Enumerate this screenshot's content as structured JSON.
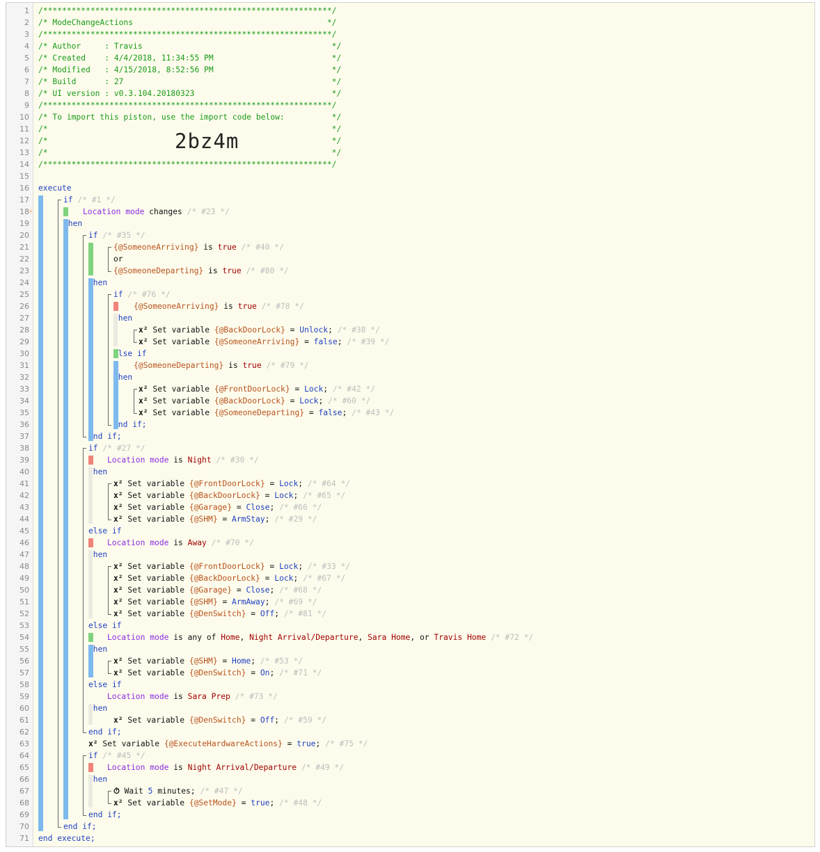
{
  "import_code": "2bz4m",
  "trigger_marker_line": 18,
  "colors": {
    "comment": "#1a9a1a",
    "keyword": "#1f3fc0",
    "variable": "#b8521d",
    "purple": "#8a2be2",
    "value": "#a00000",
    "faint": "#bdbdbd",
    "plain": "#111111"
  },
  "lines": [
    [
      [
        "c",
        "/*************************************************************/"
      ]
    ],
    [
      [
        "c",
        "/* ModeChangeActions                                         */"
      ]
    ],
    [
      [
        "c",
        "/*************************************************************/"
      ]
    ],
    [
      [
        "c",
        "/* Author     : Travis                                        */"
      ]
    ],
    [
      [
        "c",
        "/* Created    : 4/4/2018, 11:34:55 PM                         */"
      ]
    ],
    [
      [
        "c",
        "/* Modified   : 4/15/2018, 8:52:56 PM                         */"
      ]
    ],
    [
      [
        "c",
        "/* Build      : 27                                            */"
      ]
    ],
    [
      [
        "c",
        "/* UI version : v0.3.104.20180323                             */"
      ]
    ],
    [
      [
        "c",
        "/*************************************************************/"
      ]
    ],
    [
      [
        "c",
        "/* To import this piston, use the import code below:          */"
      ]
    ],
    [
      [
        "c",
        "/*                                                            */"
      ]
    ],
    [
      [
        "c",
        "/*                                                            */"
      ]
    ],
    [
      [
        "c",
        "/*                                                            */"
      ]
    ],
    [
      [
        "c",
        "/*************************************************************/"
      ]
    ],
    [],
    [
      [
        "k",
        "execute"
      ]
    ],
    [
      [
        "k",
        "if"
      ],
      [
        "f",
        " /* #1 */"
      ]
    ],
    [
      [
        "p",
        "Location mode"
      ],
      [
        "t",
        " changes"
      ],
      [
        "f",
        " /* #23 */"
      ]
    ],
    [
      [
        "k",
        "then"
      ]
    ],
    [
      [
        "k",
        "if"
      ],
      [
        "f",
        " /* #35 */"
      ]
    ],
    [
      [
        "v",
        "{@SomeoneArriving}"
      ],
      [
        "t",
        " is "
      ],
      [
        "r",
        "true"
      ],
      [
        "f",
        " /* #40 */"
      ]
    ],
    [
      [
        "t",
        "or"
      ]
    ],
    [
      [
        "v",
        "{@SomeoneDeparting}"
      ],
      [
        "t",
        " is "
      ],
      [
        "r",
        "true"
      ],
      [
        "f",
        " /* #80 */"
      ]
    ],
    [
      [
        "k",
        "then"
      ]
    ],
    [
      [
        "k",
        "if"
      ],
      [
        "f",
        " /* #76 */"
      ]
    ],
    [
      [
        "v",
        "{@SomeoneArriving}"
      ],
      [
        "t",
        " is "
      ],
      [
        "r",
        "true"
      ],
      [
        "f",
        " /* #78 */"
      ]
    ],
    [
      [
        "k",
        "then"
      ]
    ],
    [
      [
        "x",
        "x²"
      ],
      [
        "t",
        " Set variable "
      ],
      [
        "v",
        "{@BackDoorLock}"
      ],
      [
        "t",
        " = "
      ],
      [
        "k",
        "Unlock"
      ],
      [
        "t",
        ";"
      ],
      [
        "f",
        " /* #38 */"
      ]
    ],
    [
      [
        "x",
        "x²"
      ],
      [
        "t",
        " Set variable "
      ],
      [
        "v",
        "{@SomeoneArriving}"
      ],
      [
        "t",
        " = "
      ],
      [
        "k",
        "false"
      ],
      [
        "t",
        ";"
      ],
      [
        "f",
        " /* #39 */"
      ]
    ],
    [
      [
        "k",
        "else if"
      ]
    ],
    [
      [
        "v",
        "{@SomeoneDeparting}"
      ],
      [
        "t",
        " is "
      ],
      [
        "r",
        "true"
      ],
      [
        "f",
        " /* #79 */"
      ]
    ],
    [
      [
        "k",
        "then"
      ]
    ],
    [
      [
        "x",
        "x²"
      ],
      [
        "t",
        " Set variable "
      ],
      [
        "v",
        "{@FrontDoorLock}"
      ],
      [
        "t",
        " = "
      ],
      [
        "k",
        "Lock"
      ],
      [
        "t",
        ";"
      ],
      [
        "f",
        " /* #42 */"
      ]
    ],
    [
      [
        "x",
        "x²"
      ],
      [
        "t",
        " Set variable "
      ],
      [
        "v",
        "{@BackDoorLock}"
      ],
      [
        "t",
        " = "
      ],
      [
        "k",
        "Lock"
      ],
      [
        "t",
        ";"
      ],
      [
        "f",
        " /* #60 */"
      ]
    ],
    [
      [
        "x",
        "x²"
      ],
      [
        "t",
        " Set variable "
      ],
      [
        "v",
        "{@SomeoneDeparting}"
      ],
      [
        "t",
        " = "
      ],
      [
        "k",
        "false"
      ],
      [
        "t",
        ";"
      ],
      [
        "f",
        " /* #43 */"
      ]
    ],
    [
      [
        "k",
        "end if;"
      ]
    ],
    [
      [
        "k",
        "end if;"
      ]
    ],
    [
      [
        "k",
        "if"
      ],
      [
        "f",
        " /* #27 */"
      ]
    ],
    [
      [
        "p",
        "Location mode"
      ],
      [
        "t",
        " is "
      ],
      [
        "r",
        "Night"
      ],
      [
        "f",
        " /* #30 */"
      ]
    ],
    [
      [
        "k",
        "then"
      ]
    ],
    [
      [
        "x",
        "x²"
      ],
      [
        "t",
        " Set variable "
      ],
      [
        "v",
        "{@FrontDoorLock}"
      ],
      [
        "t",
        " = "
      ],
      [
        "k",
        "Lock"
      ],
      [
        "t",
        ";"
      ],
      [
        "f",
        " /* #64 */"
      ]
    ],
    [
      [
        "x",
        "x²"
      ],
      [
        "t",
        " Set variable "
      ],
      [
        "v",
        "{@BackDoorLock}"
      ],
      [
        "t",
        " = "
      ],
      [
        "k",
        "Lock"
      ],
      [
        "t",
        ";"
      ],
      [
        "f",
        " /* #65 */"
      ]
    ],
    [
      [
        "x",
        "x²"
      ],
      [
        "t",
        " Set variable "
      ],
      [
        "v",
        "{@Garage}"
      ],
      [
        "t",
        " = "
      ],
      [
        "k",
        "Close"
      ],
      [
        "t",
        ";"
      ],
      [
        "f",
        " /* #66 */"
      ]
    ],
    [
      [
        "x",
        "x²"
      ],
      [
        "t",
        " Set variable "
      ],
      [
        "v",
        "{@SHM}"
      ],
      [
        "t",
        " = "
      ],
      [
        "k",
        "ArmStay"
      ],
      [
        "t",
        ";"
      ],
      [
        "f",
        " /* #29 */"
      ]
    ],
    [
      [
        "k",
        "else if"
      ]
    ],
    [
      [
        "p",
        "Location mode"
      ],
      [
        "t",
        " is "
      ],
      [
        "r",
        "Away"
      ],
      [
        "f",
        " /* #70 */"
      ]
    ],
    [
      [
        "k",
        "then"
      ]
    ],
    [
      [
        "x",
        "x²"
      ],
      [
        "t",
        " Set variable "
      ],
      [
        "v",
        "{@FrontDoorLock}"
      ],
      [
        "t",
        " = "
      ],
      [
        "k",
        "Lock"
      ],
      [
        "t",
        ";"
      ],
      [
        "f",
        " /* #33 */"
      ]
    ],
    [
      [
        "x",
        "x²"
      ],
      [
        "t",
        " Set variable "
      ],
      [
        "v",
        "{@BackDoorLock}"
      ],
      [
        "t",
        " = "
      ],
      [
        "k",
        "Lock"
      ],
      [
        "t",
        ";"
      ],
      [
        "f",
        " /* #67 */"
      ]
    ],
    [
      [
        "x",
        "x²"
      ],
      [
        "t",
        " Set variable "
      ],
      [
        "v",
        "{@Garage}"
      ],
      [
        "t",
        " = "
      ],
      [
        "k",
        "Close"
      ],
      [
        "t",
        ";"
      ],
      [
        "f",
        " /* #68 */"
      ]
    ],
    [
      [
        "x",
        "x²"
      ],
      [
        "t",
        " Set variable "
      ],
      [
        "v",
        "{@SHM}"
      ],
      [
        "t",
        " = "
      ],
      [
        "k",
        "ArmAway"
      ],
      [
        "t",
        ";"
      ],
      [
        "f",
        " /* #69 */"
      ]
    ],
    [
      [
        "x",
        "x²"
      ],
      [
        "t",
        " Set variable "
      ],
      [
        "v",
        "{@DenSwitch}"
      ],
      [
        "t",
        " = "
      ],
      [
        "k",
        "Off"
      ],
      [
        "t",
        ";"
      ],
      [
        "f",
        " /* #81 */"
      ]
    ],
    [
      [
        "k",
        "else if"
      ]
    ],
    [
      [
        "p",
        "Location mode"
      ],
      [
        "t",
        " is any of "
      ],
      [
        "r",
        "Home"
      ],
      [
        "t",
        ", "
      ],
      [
        "r",
        "Night Arrival/Departure"
      ],
      [
        "t",
        ", "
      ],
      [
        "r",
        "Sara Home"
      ],
      [
        "t",
        ", or "
      ],
      [
        "r",
        "Travis Home"
      ],
      [
        "f",
        " /* #72 */"
      ]
    ],
    [
      [
        "k",
        "then"
      ]
    ],
    [
      [
        "x",
        "x²"
      ],
      [
        "t",
        " Set variable "
      ],
      [
        "v",
        "{@SHM}"
      ],
      [
        "t",
        " = "
      ],
      [
        "k",
        "Home"
      ],
      [
        "t",
        ";"
      ],
      [
        "f",
        " /* #53 */"
      ]
    ],
    [
      [
        "x",
        "x²"
      ],
      [
        "t",
        " Set variable "
      ],
      [
        "v",
        "{@DenSwitch}"
      ],
      [
        "t",
        " = "
      ],
      [
        "k",
        "On"
      ],
      [
        "t",
        ";"
      ],
      [
        "f",
        " /* #71 */"
      ]
    ],
    [
      [
        "k",
        "else if"
      ]
    ],
    [
      [
        "p",
        "Location mode"
      ],
      [
        "t",
        " is "
      ],
      [
        "r",
        "Sara Prep"
      ],
      [
        "f",
        " /* #73 */"
      ]
    ],
    [
      [
        "k",
        "then"
      ]
    ],
    [
      [
        "x",
        "x²"
      ],
      [
        "t",
        " Set variable "
      ],
      [
        "v",
        "{@DenSwitch}"
      ],
      [
        "t",
        " = "
      ],
      [
        "k",
        "Off"
      ],
      [
        "t",
        ";"
      ],
      [
        "f",
        " /* #59 */"
      ]
    ],
    [
      [
        "k",
        "end if;"
      ]
    ],
    [
      [
        "x",
        "x²"
      ],
      [
        "t",
        " Set variable "
      ],
      [
        "v",
        "{@ExecuteHardwareActions}"
      ],
      [
        "t",
        " = "
      ],
      [
        "k",
        "true"
      ],
      [
        "t",
        ";"
      ],
      [
        "f",
        " /* #75 */"
      ]
    ],
    [
      [
        "k",
        "if"
      ],
      [
        "f",
        " /* #45 */"
      ]
    ],
    [
      [
        "p",
        "Location mode"
      ],
      [
        "t",
        " is "
      ],
      [
        "r",
        "Night Arrival/Departure"
      ],
      [
        "f",
        " /* #49 */"
      ]
    ],
    [
      [
        "k",
        "then"
      ]
    ],
    [
      [
        "x",
        "⏱"
      ],
      [
        "t",
        " Wait "
      ],
      [
        "k",
        "5"
      ],
      [
        "t",
        " minutes;"
      ],
      [
        "f",
        " /* #47 */"
      ]
    ],
    [
      [
        "x",
        "x²"
      ],
      [
        "t",
        " Set variable "
      ],
      [
        "v",
        "{@SetMode}"
      ],
      [
        "t",
        " = "
      ],
      [
        "k",
        "true"
      ],
      [
        "t",
        ";"
      ],
      [
        "f",
        " /* #48 */"
      ]
    ],
    [
      [
        "k",
        "end if;"
      ]
    ],
    [
      [
        "k",
        "end if;"
      ]
    ],
    [
      [
        "k",
        "end execute;"
      ]
    ]
  ]
}
